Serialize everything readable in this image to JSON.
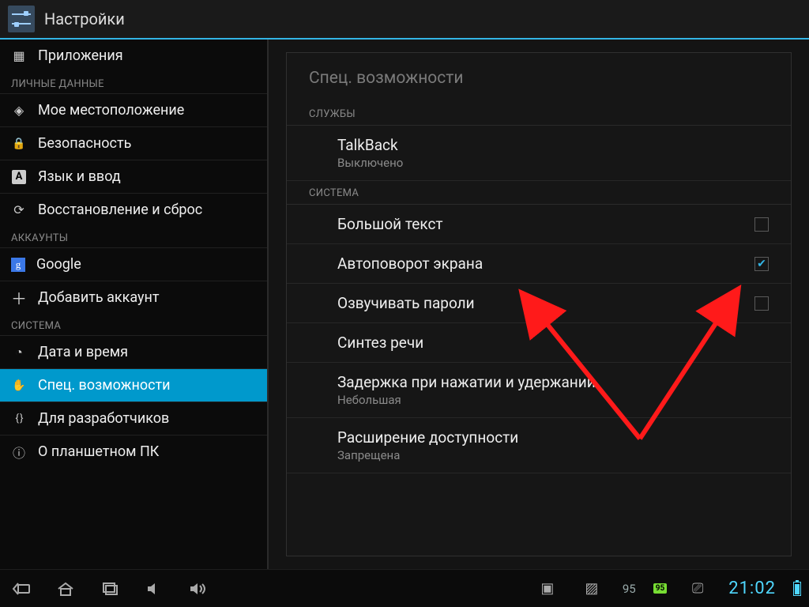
{
  "titlebar": {
    "title": "Настройки"
  },
  "sidebar": {
    "top_item": {
      "label": "Приложения"
    },
    "sections": [
      {
        "header": "ЛИЧНЫЕ ДАННЫЕ",
        "items": [
          {
            "id": "location",
            "label": "Мое местоположение",
            "icon": "gi-loc"
          },
          {
            "id": "security",
            "label": "Безопасность",
            "icon": "gi-lock"
          },
          {
            "id": "language",
            "label": "Язык и ввод",
            "icon": "gi-lang"
          },
          {
            "id": "reset",
            "label": "Восстановление и сброс",
            "icon": "gi-reset"
          }
        ]
      },
      {
        "header": "АККАУНТЫ",
        "items": [
          {
            "id": "google",
            "label": "Google",
            "icon": "gi-google"
          },
          {
            "id": "addacct",
            "label": "Добавить аккаунт",
            "icon": "gi-plus"
          }
        ]
      },
      {
        "header": "СИСТЕМА",
        "items": [
          {
            "id": "datetime",
            "label": "Дата и время",
            "icon": "gi-clock"
          },
          {
            "id": "a11y",
            "label": "Спец. возможности",
            "icon": "gi-hand",
            "selected": true
          },
          {
            "id": "dev",
            "label": "Для разработчиков",
            "icon": "gi-dev"
          },
          {
            "id": "about",
            "label": "О планшетном ПК",
            "icon": "gi-info"
          }
        ]
      }
    ]
  },
  "detail": {
    "title": "Спец. возможности",
    "groups": [
      {
        "header": "СЛУЖБЫ",
        "prefs": [
          {
            "id": "talkback",
            "label": "TalkBack",
            "sub": "Выключено",
            "checkbox": null
          }
        ]
      },
      {
        "header": "СИСТЕМА",
        "prefs": [
          {
            "id": "largetext",
            "label": "Большой текст",
            "checkbox": false
          },
          {
            "id": "autorotate",
            "label": "Автоповорот экрана",
            "checkbox": true
          },
          {
            "id": "speakpwd",
            "label": "Озвучивать пароли",
            "checkbox": false
          },
          {
            "id": "tts",
            "label": "Синтез речи",
            "checkbox": null
          },
          {
            "id": "touchdelay",
            "label": "Задержка при нажатии и удержании",
            "sub": "Небольшая",
            "checkbox": null
          },
          {
            "id": "a11yext",
            "label": "Расширение доступности",
            "sub": "Запрещена",
            "checkbox": null
          }
        ]
      }
    ]
  },
  "navbar": {
    "battery_pct": "95",
    "battery_badge": "95",
    "clock": "21:02"
  },
  "annotation": {
    "desc": "Two red arrows pointing to 'Автоповорот экрана' label and its checked checkbox"
  }
}
